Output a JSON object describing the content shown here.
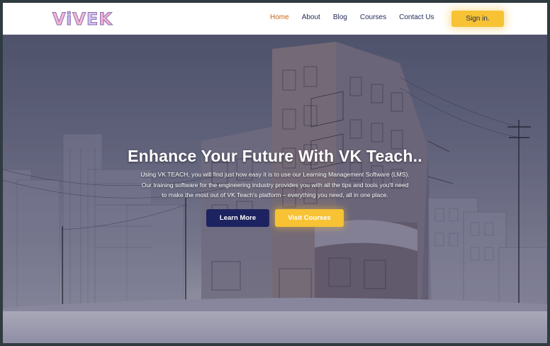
{
  "logo": {
    "letters": [
      "V",
      "i",
      "V",
      "E",
      "K"
    ],
    "text": "ViVEK"
  },
  "nav": {
    "items": [
      {
        "label": "Home",
        "active": true
      },
      {
        "label": "About",
        "active": false
      },
      {
        "label": "Blog",
        "active": false
      },
      {
        "label": "Courses",
        "active": false
      },
      {
        "label": "Contact Us",
        "active": false
      }
    ],
    "signin_label": "Sign in."
  },
  "hero": {
    "title": "Enhance Your Future With VK Teach..",
    "desc_line1": "Using VK TEACH, you will find just how easy it is to use our Learning Management Software (LMS).",
    "desc_line2": "Our training software for the engineering industry provides you with all the tips and tools you'll need",
    "desc_line3": "to make the most out of VK Teach's platform – everything you need, all in one place.",
    "learn_more_label": "Learn More",
    "visit_courses_label": "Visit Courses"
  },
  "colors": {
    "accent": "#f7c234",
    "primary_dark": "#1d2260",
    "nav_active": "#c8641b",
    "nav_text": "#1f2a55"
  }
}
